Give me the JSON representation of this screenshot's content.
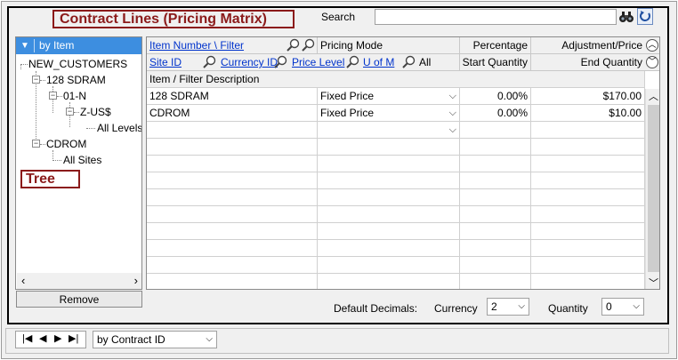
{
  "title": "Contract Lines (Pricing Matrix)",
  "search": {
    "label": "Search",
    "value": ""
  },
  "tree": {
    "header": "by Item",
    "nodes": [
      "NEW_CUSTOMERS",
      "128 SDRAM",
      "01-N",
      "Z-US$",
      "All Levels",
      "CDROM",
      "All Sites"
    ],
    "tag": "Tree",
    "remove_label": "Remove"
  },
  "grid": {
    "header1": {
      "item_number": "Item Number \\ Filter",
      "pricing_mode": "Pricing Mode",
      "percentage": "Percentage",
      "adjustment": "Adjustment/Price"
    },
    "header2": {
      "site_id": "Site ID",
      "currency_id": "Currency ID",
      "price_level": "Price Level",
      "u_of_m": "U of M",
      "all": "All",
      "start_qty": "Start Quantity",
      "end_qty": "End Quantity"
    },
    "filter_desc": "Item / Filter Description",
    "rows": [
      {
        "item": "128 SDRAM",
        "mode": "Fixed Price",
        "pct": "0.00%",
        "price": "$170.00"
      },
      {
        "item": "CDROM",
        "mode": "Fixed Price",
        "pct": "0.00%",
        "price": "$10.00"
      }
    ]
  },
  "decimals": {
    "label": "Default Decimals:",
    "currency_label": "Currency",
    "currency_value": "2",
    "quantity_label": "Quantity",
    "quantity_value": "0"
  },
  "nav": {
    "sort_by": "by Contract ID"
  },
  "icons": [
    "binoculars-icon",
    "refresh-icon",
    "magnifier-icon",
    "chevron-up-icon",
    "chevron-down-icon",
    "first-icon",
    "previous-icon",
    "next-icon",
    "last-icon"
  ],
  "colors": {
    "title_border": "#8b1a1a",
    "tree_header_bg": "#3d8ee0",
    "link": "#0033cc"
  }
}
